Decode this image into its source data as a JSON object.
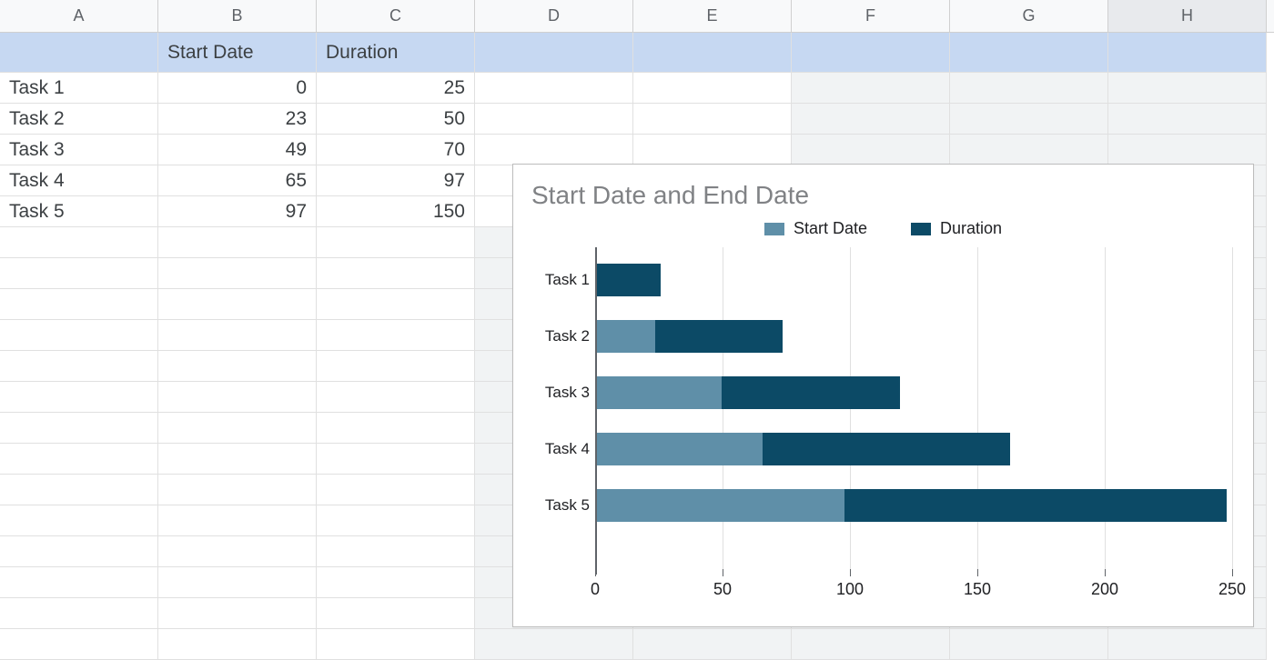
{
  "columns": [
    "A",
    "B",
    "C",
    "D",
    "E",
    "F",
    "G",
    "H"
  ],
  "selected_column_index": 7,
  "header_row": {
    "a": "",
    "b": "Start Date",
    "c": "Duration"
  },
  "data_rows": [
    {
      "task": "Task 1",
      "start": 0,
      "duration": 25
    },
    {
      "task": "Task 2",
      "start": 23,
      "duration": 50
    },
    {
      "task": "Task 3",
      "start": 49,
      "duration": 70
    },
    {
      "task": "Task 4",
      "start": 65,
      "duration": 97
    },
    {
      "task": "Task 5",
      "start": 97,
      "duration": 150
    }
  ],
  "blank_rows": 14,
  "chart_data": {
    "type": "bar",
    "orientation": "horizontal",
    "stacked": true,
    "title": "Start Date and End Date",
    "categories": [
      "Task 1",
      "Task 2",
      "Task 3",
      "Task 4",
      "Task 5"
    ],
    "series": [
      {
        "name": "Start Date",
        "color": "#5f8fa8",
        "values": [
          0,
          23,
          49,
          65,
          97
        ]
      },
      {
        "name": "Duration",
        "color": "#0c4a66",
        "values": [
          25,
          50,
          70,
          97,
          150
        ]
      }
    ],
    "xlim": [
      0,
      250
    ],
    "x_ticks": [
      0,
      50,
      100,
      150,
      200,
      250
    ],
    "xlabel": "",
    "ylabel": ""
  }
}
